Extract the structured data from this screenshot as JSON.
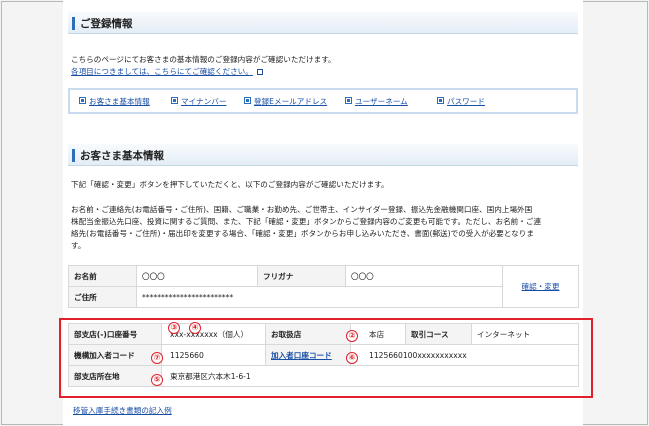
{
  "registration": {
    "title": "ご登録情報",
    "intro": "こちらのページにてお客さまの基本情報のご登録内容がご確認いただけます。",
    "help_link": "各項目につきましては、こちらにてご確認ください。",
    "nav": [
      "お客さま基本情報",
      "マイナンバー",
      "登録Eメールアドレス",
      "ユーザーネーム",
      "パスワード"
    ]
  },
  "basic": {
    "title": "お客さま基本情報",
    "note1": "下記「確認・変更」ボタンを押下していただくと、以下のご登録内容がご確認いただけます。",
    "note2_line1": "お名前・ご連絡先(お電話番号・ご住所)、国籍、ご職業・お勤め先、ご世帯主、インサイダー登録、振込先金融機関口座、国内上場外国",
    "note2_line2": "株配当金振込先口座、投資に関するご質問、また、下記「確認・変更」ボタンからご登録内容のご変更も可能です。ただし、お名前・ご連",
    "note2_line3": "絡先(お電話番号・ご住所)・届出印を変更する場合、「確認・変更」ボタンからお申し込みいただき、書面(郵送)での受入が必要となりま",
    "note2_line4": "す。",
    "name_label": "お名前",
    "name_value": "〇〇〇",
    "furigana_label": "フリガナ",
    "furigana_value": "〇〇〇",
    "address_label": "ご住所",
    "address_value": "************************",
    "edit_link": "確認・変更"
  },
  "account": {
    "branch_label": "部支店(-)口座番号",
    "branch_value": "xxx-xxxxxxx（個人）",
    "handling_label": "お取扱店",
    "handling_value": "本店",
    "course_label": "取引コース",
    "course_value": "インターネット",
    "member_label": "機構加入者コード",
    "member_value": "1125660",
    "subscriber_label": "加入者口座コード",
    "subscriber_value": "1125660100xxxxxxxxxxx",
    "location_label": "部支店所在地",
    "location_value": "東京都港区六本木1-6-1",
    "markers": [
      "③",
      "④",
      "②",
      "⑦",
      "⑥",
      "⑤"
    ]
  },
  "footer_link": "移管入庫手続き書類の記入例",
  "colors": {
    "accent": "#2b6fb8",
    "link": "#1a4fa8",
    "highlight": "#e0202a"
  }
}
